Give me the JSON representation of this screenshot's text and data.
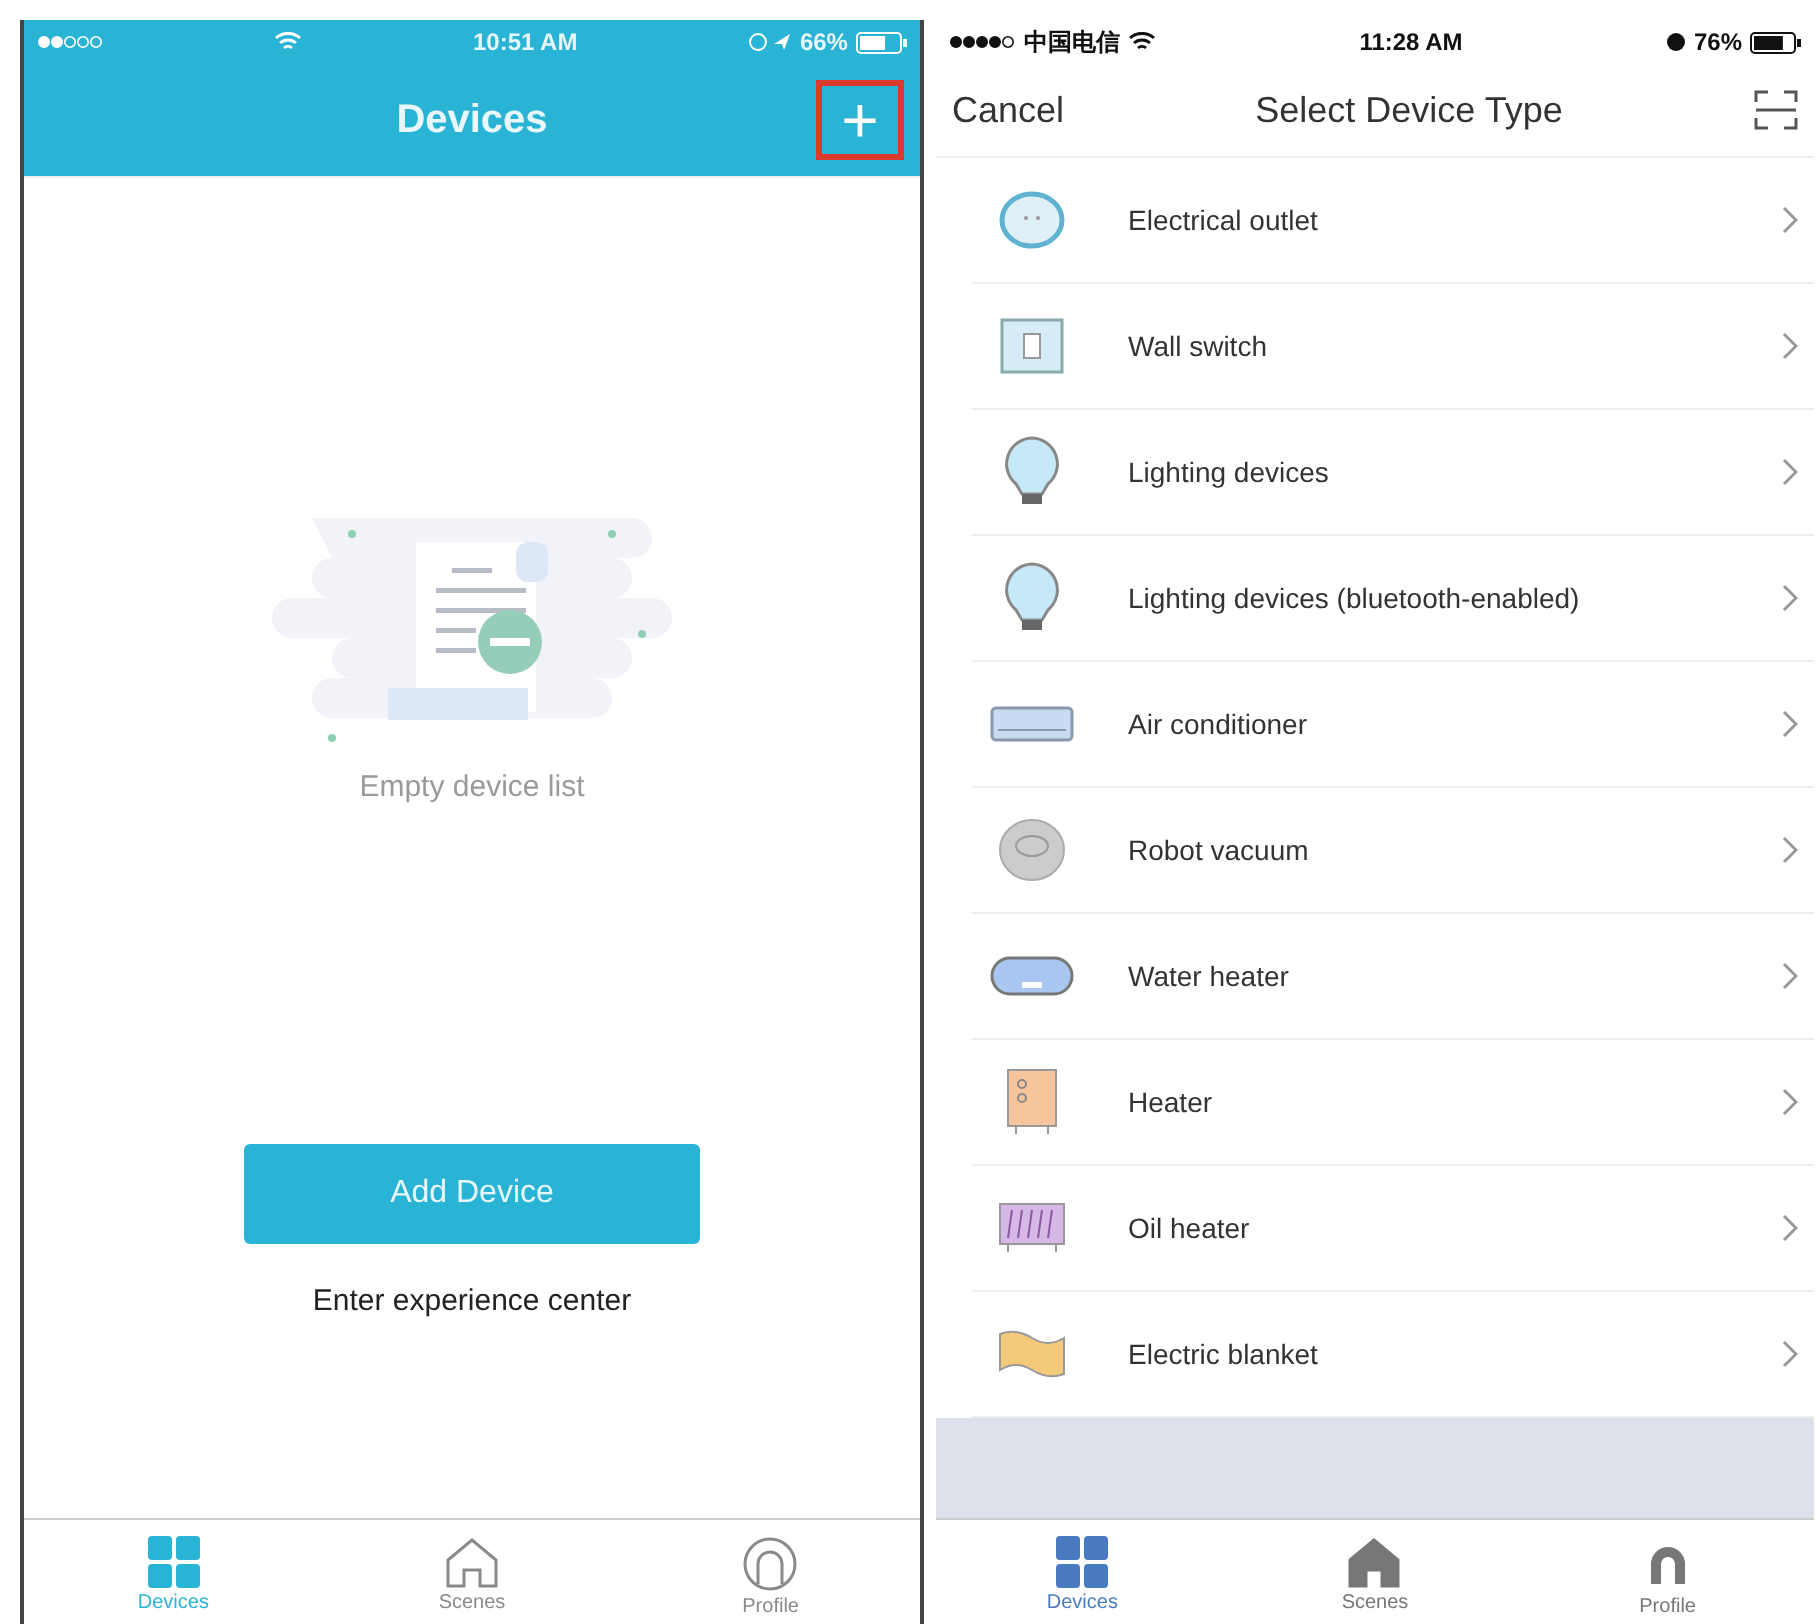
{
  "left_screen": {
    "status_bar": {
      "time": "10:51 AM",
      "battery": "66%"
    },
    "nav_bar": {
      "title": "Devices",
      "add_button": {
        "label": "+",
        "highlighted": true
      }
    },
    "empty_state": {
      "message": "Empty device list"
    },
    "add_device_button": "Add Device",
    "experience_link": "Enter experience center",
    "tab_bar": [
      {
        "label": "Devices",
        "kind": "grid",
        "selected": true
      },
      {
        "label": "Scenes",
        "kind": "home",
        "selected": false
      },
      {
        "label": "Profile",
        "kind": "person",
        "selected": false
      }
    ]
  },
  "right_screen": {
    "status_bar": {
      "carrier": "中国电信",
      "time": "11:28 AM",
      "battery": "76%"
    },
    "nav_bar": {
      "cancel": "Cancel",
      "title": "Select Device Type"
    },
    "device_types": [
      {
        "label": "Electrical outlet",
        "kind": "outlet"
      },
      {
        "label": "Wall switch",
        "kind": "switch"
      },
      {
        "label": "Lighting devices",
        "kind": "bulb"
      },
      {
        "label": "Lighting devices (bluetooth-enabled)",
        "kind": "bulb"
      },
      {
        "label": "Air conditioner",
        "kind": "ac"
      },
      {
        "label": "Robot vacuum",
        "kind": "vacuum"
      },
      {
        "label": "Water heater",
        "kind": "waterheater"
      },
      {
        "label": "Heater",
        "kind": "heater"
      },
      {
        "label": "Oil heater",
        "kind": "oilheater"
      },
      {
        "label": "Electric blanket",
        "kind": "blanket"
      }
    ],
    "tab_bar": [
      {
        "label": "Devices",
        "kind": "grid",
        "selected": true
      },
      {
        "label": "Scenes",
        "kind": "home",
        "selected": false
      },
      {
        "label": "Profile",
        "kind": "person",
        "selected": false
      }
    ]
  }
}
